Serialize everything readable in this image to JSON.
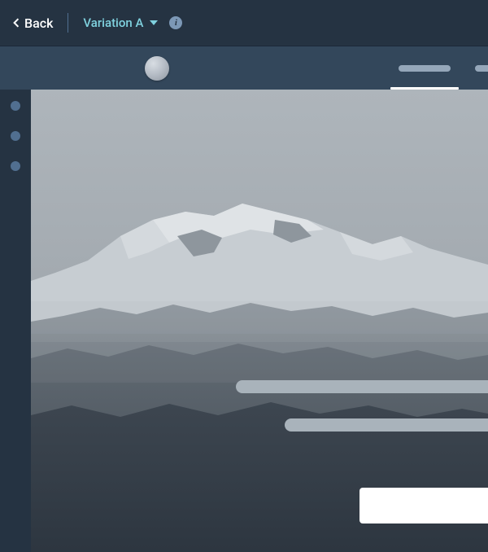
{
  "header": {
    "back_label": "Back",
    "variation_label": "Variation A",
    "info_glyph": "i"
  },
  "toolbar": {
    "tabs": [
      {
        "id": "tab1",
        "active": true
      },
      {
        "id": "tab2",
        "active": false
      }
    ]
  },
  "side_rail": {
    "items": [
      {
        "id": "dot1"
      },
      {
        "id": "dot2"
      },
      {
        "id": "dot3"
      }
    ]
  },
  "canvas": {
    "overlay": {
      "line1": "",
      "line2": "",
      "button_label": ""
    }
  }
}
